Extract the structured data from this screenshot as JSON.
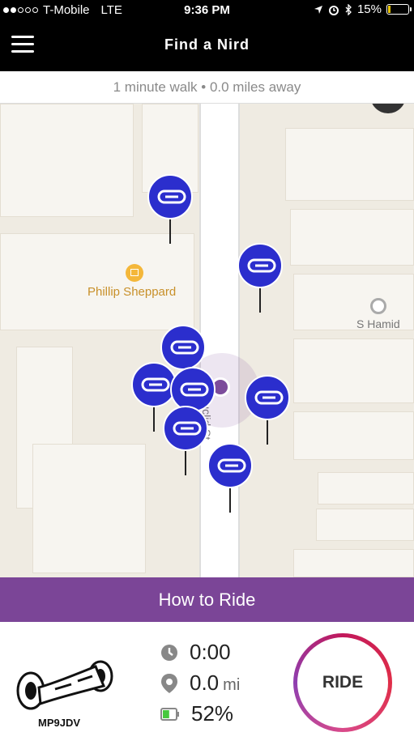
{
  "status_bar": {
    "carrier": "T-Mobile",
    "network": "LTE",
    "time": "9:36 PM",
    "battery_percent": "15%",
    "battery_level": 0.15,
    "battery_color": "#e8c400"
  },
  "nav": {
    "title": "Find a Nird",
    "menu_icon": "hamburger-icon"
  },
  "walk_info": "1 minute walk • 0.0 miles away",
  "map": {
    "poi_library_label": "Phillip Sheppard",
    "poi_place_label": "S Hamid",
    "street_label": "Euclid St",
    "pin_color": "#2b2ecd",
    "pin_icon": "hoverboard-icon",
    "user_dot_color": "#7c4c9b"
  },
  "how_to_ride": "How to Ride",
  "board": {
    "id": "MP9JDV"
  },
  "stats": {
    "time": "0:00",
    "distance": "0.0",
    "distance_unit": "mi",
    "battery": "52%",
    "battery_level": 0.52
  },
  "ride_button": "RIDE",
  "colors": {
    "accent": "#7b4597",
    "ride_ring": "#c2185b"
  }
}
